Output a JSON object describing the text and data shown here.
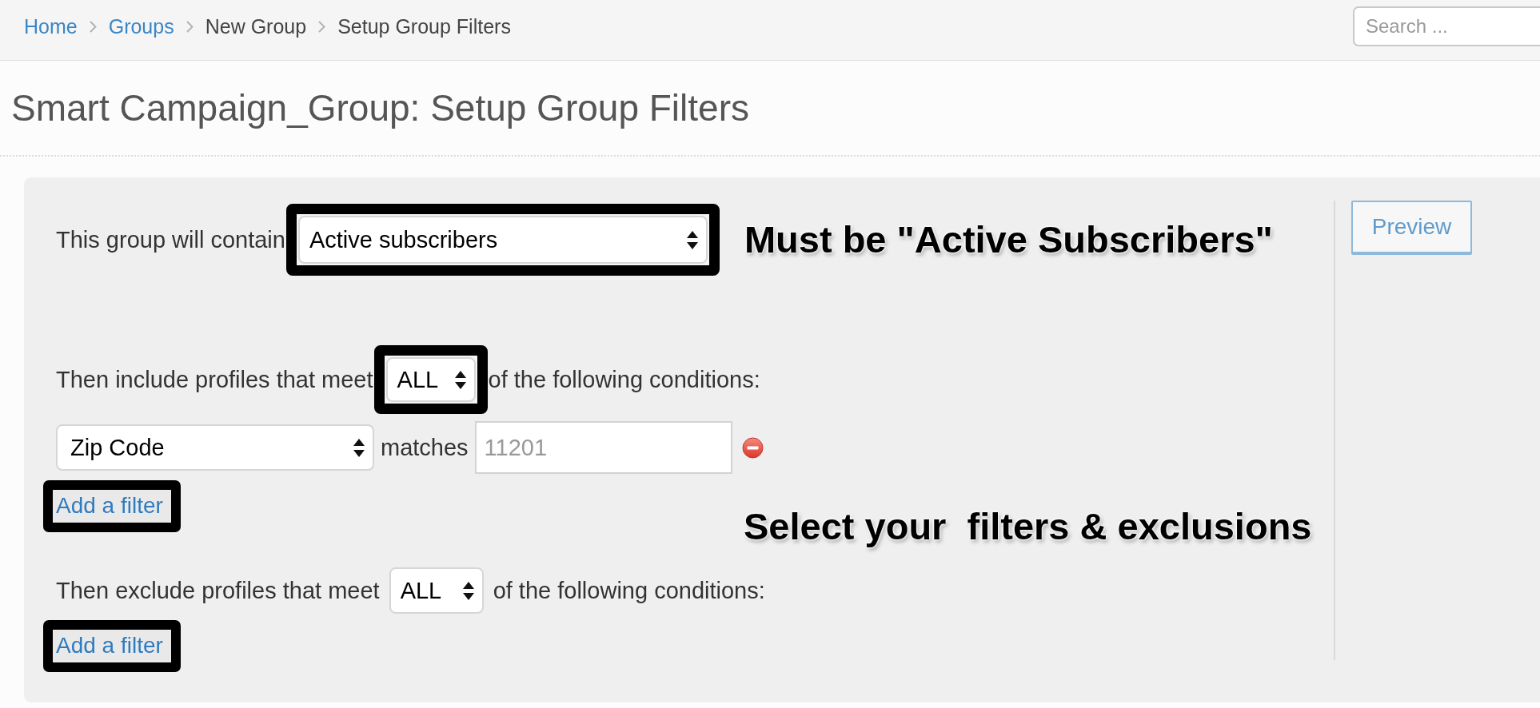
{
  "breadcrumb": [
    {
      "label": "Home",
      "kind": "link"
    },
    {
      "label": "Groups",
      "kind": "link"
    },
    {
      "label": "New Group",
      "kind": "text"
    },
    {
      "label": "Setup Group Filters",
      "kind": "text"
    }
  ],
  "search": {
    "placeholder": "Search ..."
  },
  "page_title": "Smart Campaign_Group: Setup Group Filters",
  "contain": {
    "label": "This group will contain",
    "value": "Active subscribers",
    "highlighted": true
  },
  "include": {
    "label": "Then include profiles that meet",
    "value": "ALL",
    "highlighted": true,
    "suffix": "of the following conditions:",
    "filters": [
      {
        "field": "Zip Code",
        "operator": "matches",
        "placeholder": "11201"
      }
    ],
    "add_filter": {
      "label": "Add a filter",
      "highlighted": true
    }
  },
  "exclude": {
    "label": "Then exclude profiles that meet",
    "value": "ALL",
    "highlighted": false,
    "suffix": "of the following conditions:",
    "add_filter": {
      "label": "Add a filter",
      "highlighted": true
    }
  },
  "preview_button": {
    "label": "Preview"
  },
  "annotations": [
    {
      "text": "Must be \"Active Subscribers\""
    },
    {
      "text": "Select your  filters & exclusions"
    }
  ]
}
